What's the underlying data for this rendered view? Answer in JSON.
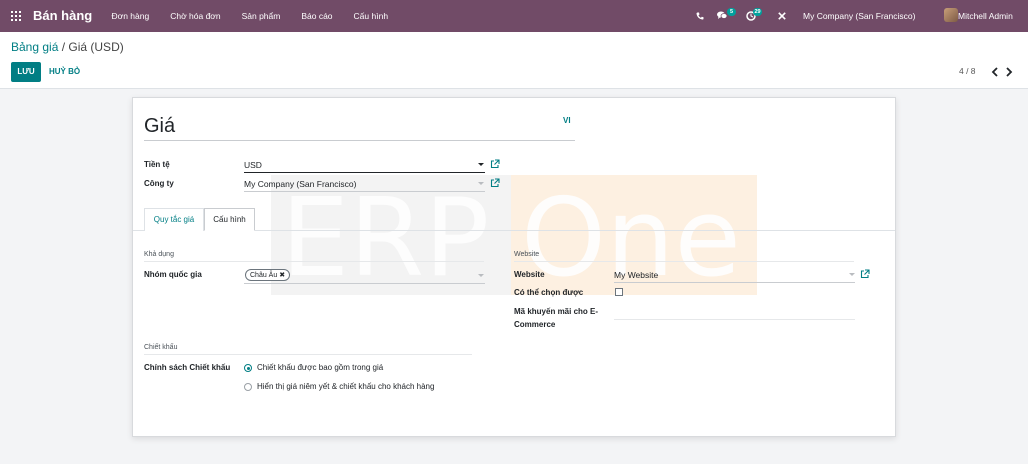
{
  "navbar": {
    "app_name": "Bán hàng",
    "menu": [
      "Đơn hàng",
      "Chờ hóa đơn",
      "Sản phẩm",
      "Báo cáo",
      "Cấu hình"
    ],
    "messages_count": "5",
    "activities_count": "29",
    "company": "My Company (San Francisco)",
    "user": "Mitchell Admin",
    "icons": [
      "apps-icon",
      "phone-icon",
      "chat-icon",
      "clock-icon",
      "close-icon"
    ]
  },
  "control_panel": {
    "breadcrumb_parent": "Bảng giá",
    "breadcrumb_sep": " / ",
    "breadcrumb_current": "Giá (USD)",
    "save_label": "LƯU",
    "discard_label": "HUỶ BỎ",
    "pager": "4 / 8"
  },
  "form": {
    "title": "Giá",
    "lang": "VI",
    "currency_label": "Tiền tệ",
    "currency_value": "USD",
    "company_label": "Công ty",
    "company_value": "My Company (San Francisco)",
    "tabs": [
      "Quy tắc giá",
      "Cấu hình"
    ],
    "availability_section": "Khả dụng",
    "country_group_label": "Nhóm quốc gia",
    "country_group_tag": "Châu Âu",
    "website_section": "Website",
    "website_label": "Website",
    "website_value": "My Website",
    "selectable_label": "Có thể chọn được",
    "selectable_checked": false,
    "promo_label_line1": "Mã khuyến mãi cho E-",
    "promo_label_line2": "Commerce",
    "discount_section": "Chiết khấu",
    "discount_policy_label": "Chính sách Chiết khấu",
    "discount_options": [
      "Chiết khấu được bao gồm trong giá",
      "Hiển thị giá niêm yết & chiết khấu cho khách hàng"
    ],
    "discount_selected_index": 0
  },
  "watermark_text": "ERPOne",
  "colors": {
    "navbar": "#714b67",
    "accent": "#017e84",
    "badge": "#00a09d",
    "watermark_orange": "#f5a54a"
  }
}
